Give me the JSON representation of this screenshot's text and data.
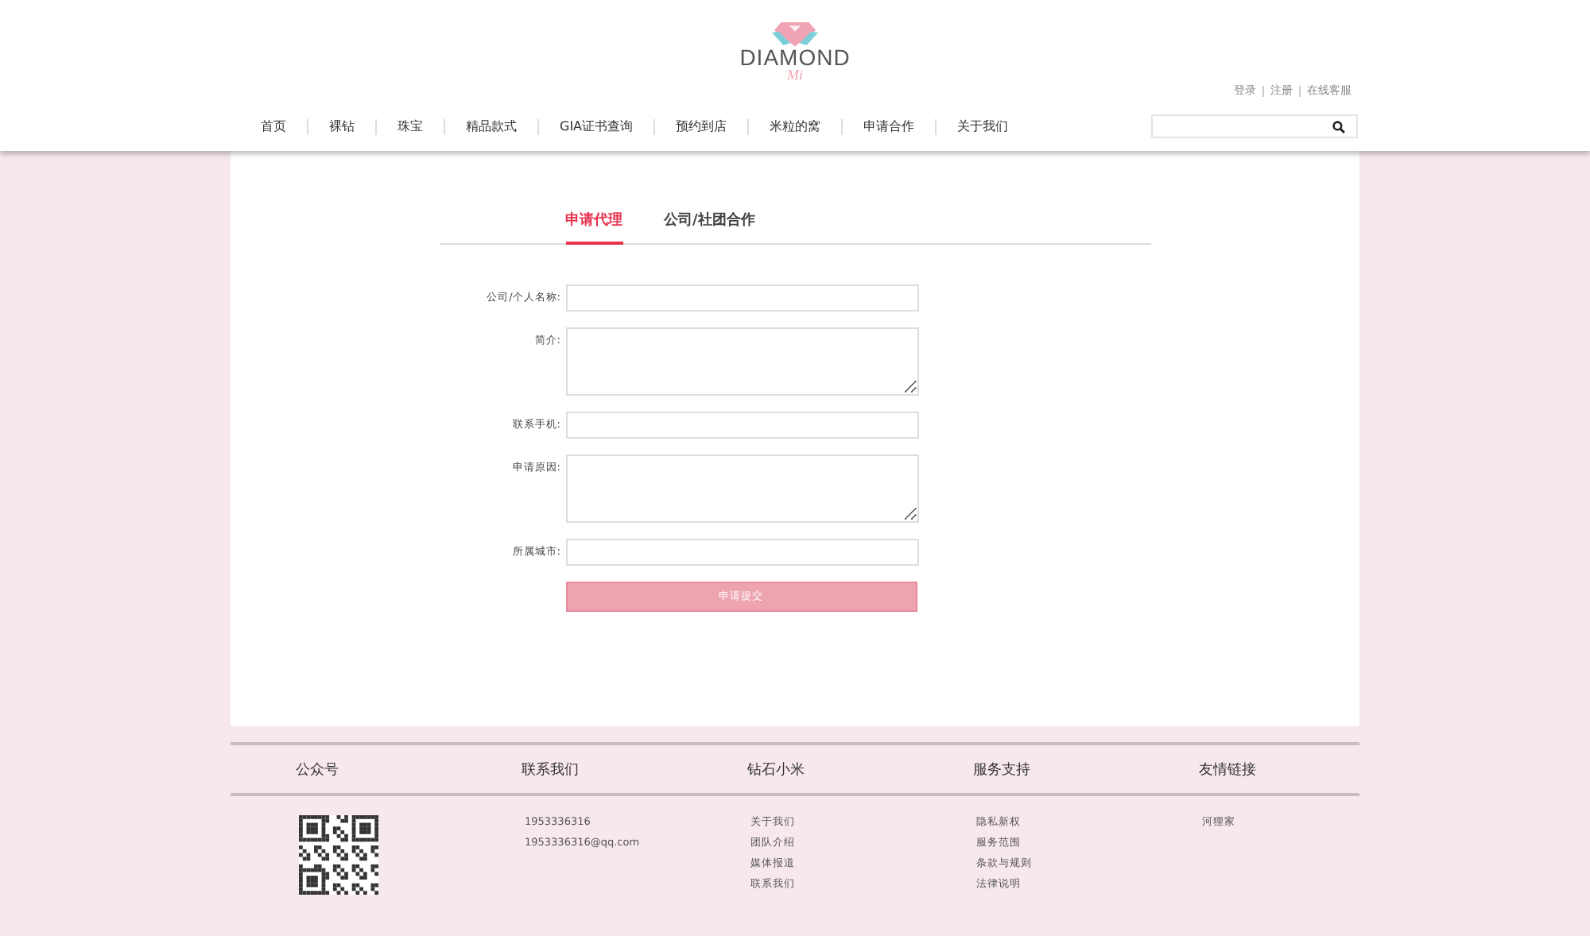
{
  "logo": {
    "title": "DIAMOND",
    "subtitle": "Mi"
  },
  "top_links": [
    "登录",
    "注册",
    "在线客服"
  ],
  "nav": [
    {
      "label": "首页"
    },
    {
      "label": "裸钻"
    },
    {
      "label": "珠宝"
    },
    {
      "label": "精品款式"
    },
    {
      "label": "GIA证书查询"
    },
    {
      "label": "预约到店"
    },
    {
      "label": "米粒的窝"
    },
    {
      "label": "申请合作"
    },
    {
      "label": "关于我们"
    }
  ],
  "tabs": [
    {
      "label": "申请代理",
      "selected": true
    },
    {
      "label": "公司/社团合作",
      "selected": false
    }
  ],
  "form": {
    "fields": [
      {
        "label": "公司/个人名称:",
        "kind": "input"
      },
      {
        "label": "简介:",
        "kind": "textarea"
      },
      {
        "label": "联系手机:",
        "kind": "input"
      },
      {
        "label": "申请原因:",
        "kind": "textarea"
      },
      {
        "label": "所属城市:",
        "kind": "input"
      }
    ],
    "submit": "申请提交"
  },
  "footer": {
    "columns": [
      {
        "title": "公众号",
        "kind": "qr"
      },
      {
        "title": "联系我们",
        "kind": "text",
        "items": [
          "1953336316",
          "1953336316@qq.com"
        ]
      },
      {
        "title": "钻石小米",
        "kind": "links",
        "items": [
          "关于我们",
          "团队介绍",
          "媒体报道",
          "联系我们"
        ]
      },
      {
        "title": "服务支持",
        "kind": "links",
        "items": [
          "隐私新权",
          "服务范围",
          "条款与规则",
          "法律说明"
        ]
      },
      {
        "title": "友情链接",
        "kind": "links",
        "items": [
          "河狸家"
        ]
      }
    ]
  }
}
